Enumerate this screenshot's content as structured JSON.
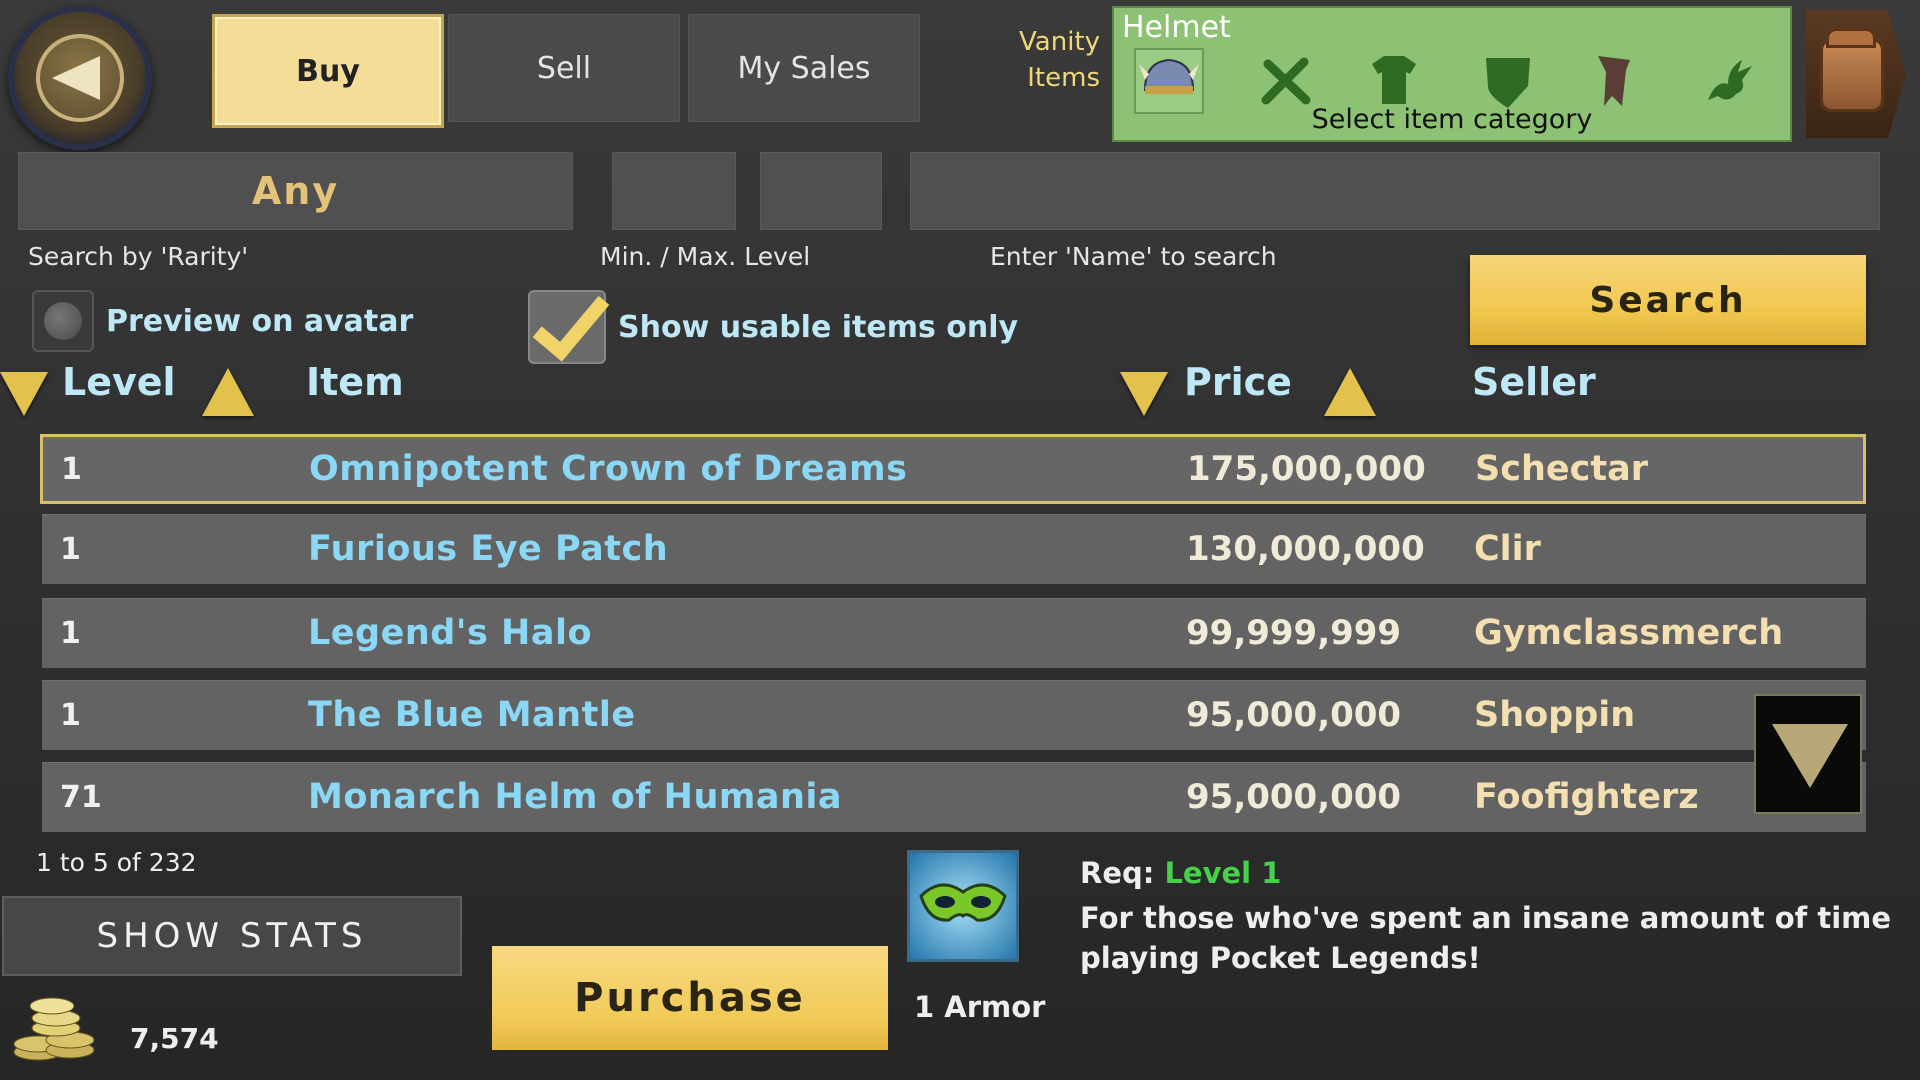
{
  "tabs": [
    {
      "label": "Buy",
      "active": true
    },
    {
      "label": "Sell",
      "active": false
    },
    {
      "label": "My Sales",
      "active": false
    }
  ],
  "vanity_label": [
    "Vanity",
    "Items"
  ],
  "category": {
    "title": "Helmet",
    "hint": "Select item category",
    "icons": [
      "helmet-icon",
      "swords-icon",
      "armor-icon",
      "shield-icon",
      "cape-icon",
      "pet-dragon-icon"
    ]
  },
  "filters": {
    "rarity_value": "Any",
    "rarity_label": "Search by 'Rarity'",
    "level_label": "Min. / Max. Level",
    "name_label": "Enter 'Name' to search",
    "search_button": "Search",
    "preview_label": "Preview on avatar",
    "usable_label": "Show usable items only"
  },
  "table": {
    "headers": {
      "level": "Level",
      "item": "Item",
      "price": "Price",
      "seller": "Seller"
    },
    "rows": [
      {
        "level": "1",
        "item": "Omnipotent Crown of Dreams",
        "price": "175,000,000",
        "seller": "Schectar",
        "selected": true
      },
      {
        "level": "1",
        "item": "Furious Eye Patch",
        "price": "130,000,000",
        "seller": "Clir"
      },
      {
        "level": "1",
        "item": "Legend's Halo",
        "price": "99,999,999",
        "seller": "Gymclassmerch"
      },
      {
        "level": "1",
        "item": "The Blue Mantle",
        "price": "95,000,000",
        "seller": "Shoppin"
      },
      {
        "level": "71",
        "item": "Monarch Helm of Humania",
        "price": "95,000,000",
        "seller": "Foofighterz"
      }
    ],
    "count_label": "1 to 5 of 232"
  },
  "bottom": {
    "show_stats": "SHOW STATS",
    "purchase": "Purchase",
    "gold": "7,574",
    "armor": "1 Armor",
    "req_prefix": "Req: ",
    "req_level": "Level 1",
    "description": "For those who've spent an insane amount of time playing Pocket Legends!"
  },
  "colors": {
    "accent_gold": "#f1c84f",
    "category_green": "#8dc275",
    "item_blue": "#8ad8f5"
  }
}
